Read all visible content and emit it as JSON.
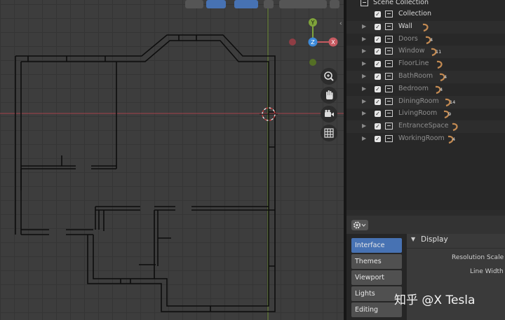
{
  "outliner": {
    "root": "Scene Collection",
    "rows": [
      {
        "label": "Collection",
        "expand": false,
        "dim": false,
        "count": ""
      },
      {
        "label": "Wall",
        "expand": true,
        "dim": false,
        "count": ""
      },
      {
        "label": "Doors",
        "expand": true,
        "dim": true,
        "count": "4"
      },
      {
        "label": "Window",
        "expand": true,
        "dim": true,
        "count": "11"
      },
      {
        "label": "FloorLine",
        "expand": true,
        "dim": true,
        "count": ""
      },
      {
        "label": "BathRoom",
        "expand": true,
        "dim": true,
        "count": "4"
      },
      {
        "label": "Bedroom",
        "expand": true,
        "dim": true,
        "count": "4"
      },
      {
        "label": "DiningRoom",
        "expand": true,
        "dim": true,
        "count": "14"
      },
      {
        "label": "LivingRoom",
        "expand": true,
        "dim": true,
        "count": "9"
      },
      {
        "label": "EntranceSpace",
        "expand": true,
        "dim": true,
        "count": ""
      },
      {
        "label": "WorkingRoom",
        "expand": true,
        "dim": true,
        "count": "4"
      }
    ]
  },
  "gizmo": {
    "y": "Y",
    "z": "Z",
    "x": "X"
  },
  "prefs": {
    "tabs": [
      "Interface",
      "Themes",
      "Viewport",
      "Lights",
      "Editing"
    ],
    "active_tab": "Interface",
    "section": "Display",
    "fields": [
      "Resolution Scale",
      "Line Width"
    ]
  },
  "watermark": {
    "site": "知乎",
    "handle": "@X Tesla"
  },
  "colors": {
    "accent": "#4772b3",
    "axis_x": "#c65a61",
    "axis_y": "#7fa33b",
    "axis_z": "#3d8ad9",
    "curve": "#c38a52"
  },
  "icons": [
    "expand-chevron-icon",
    "checkbox-icon",
    "collection-icon",
    "curve-icon",
    "zoom-icon",
    "hand-icon",
    "camera-icon",
    "grid-icon",
    "gear-icon",
    "cursor-icon"
  ]
}
